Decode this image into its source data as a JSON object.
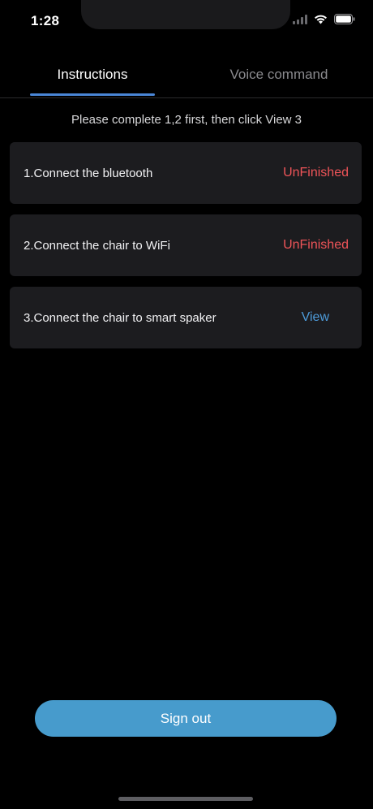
{
  "status_bar": {
    "time": "1:28",
    "icons": [
      "signal-icon",
      "wifi-icon",
      "battery-icon"
    ]
  },
  "tabs": [
    {
      "label": "Instructions",
      "active": true
    },
    {
      "label": "Voice command",
      "active": false
    }
  ],
  "hint": "Please complete 1,2 first, then click View 3",
  "steps": [
    {
      "label": "1.Connect the bluetooth",
      "status": "UnFinished"
    },
    {
      "label": "2.Connect the chair to WiFi",
      "status": "UnFinished"
    },
    {
      "label": "3.Connect the chair to smart spaker",
      "status": "View"
    }
  ],
  "signout_label": "Sign out",
  "colors": {
    "background": "#000000",
    "card": "#1c1c1f",
    "accent_tab": "#4a86d6",
    "status_unfinished": "#ee5458",
    "status_view": "#4d9bd9",
    "signout_button": "#479bcc"
  }
}
